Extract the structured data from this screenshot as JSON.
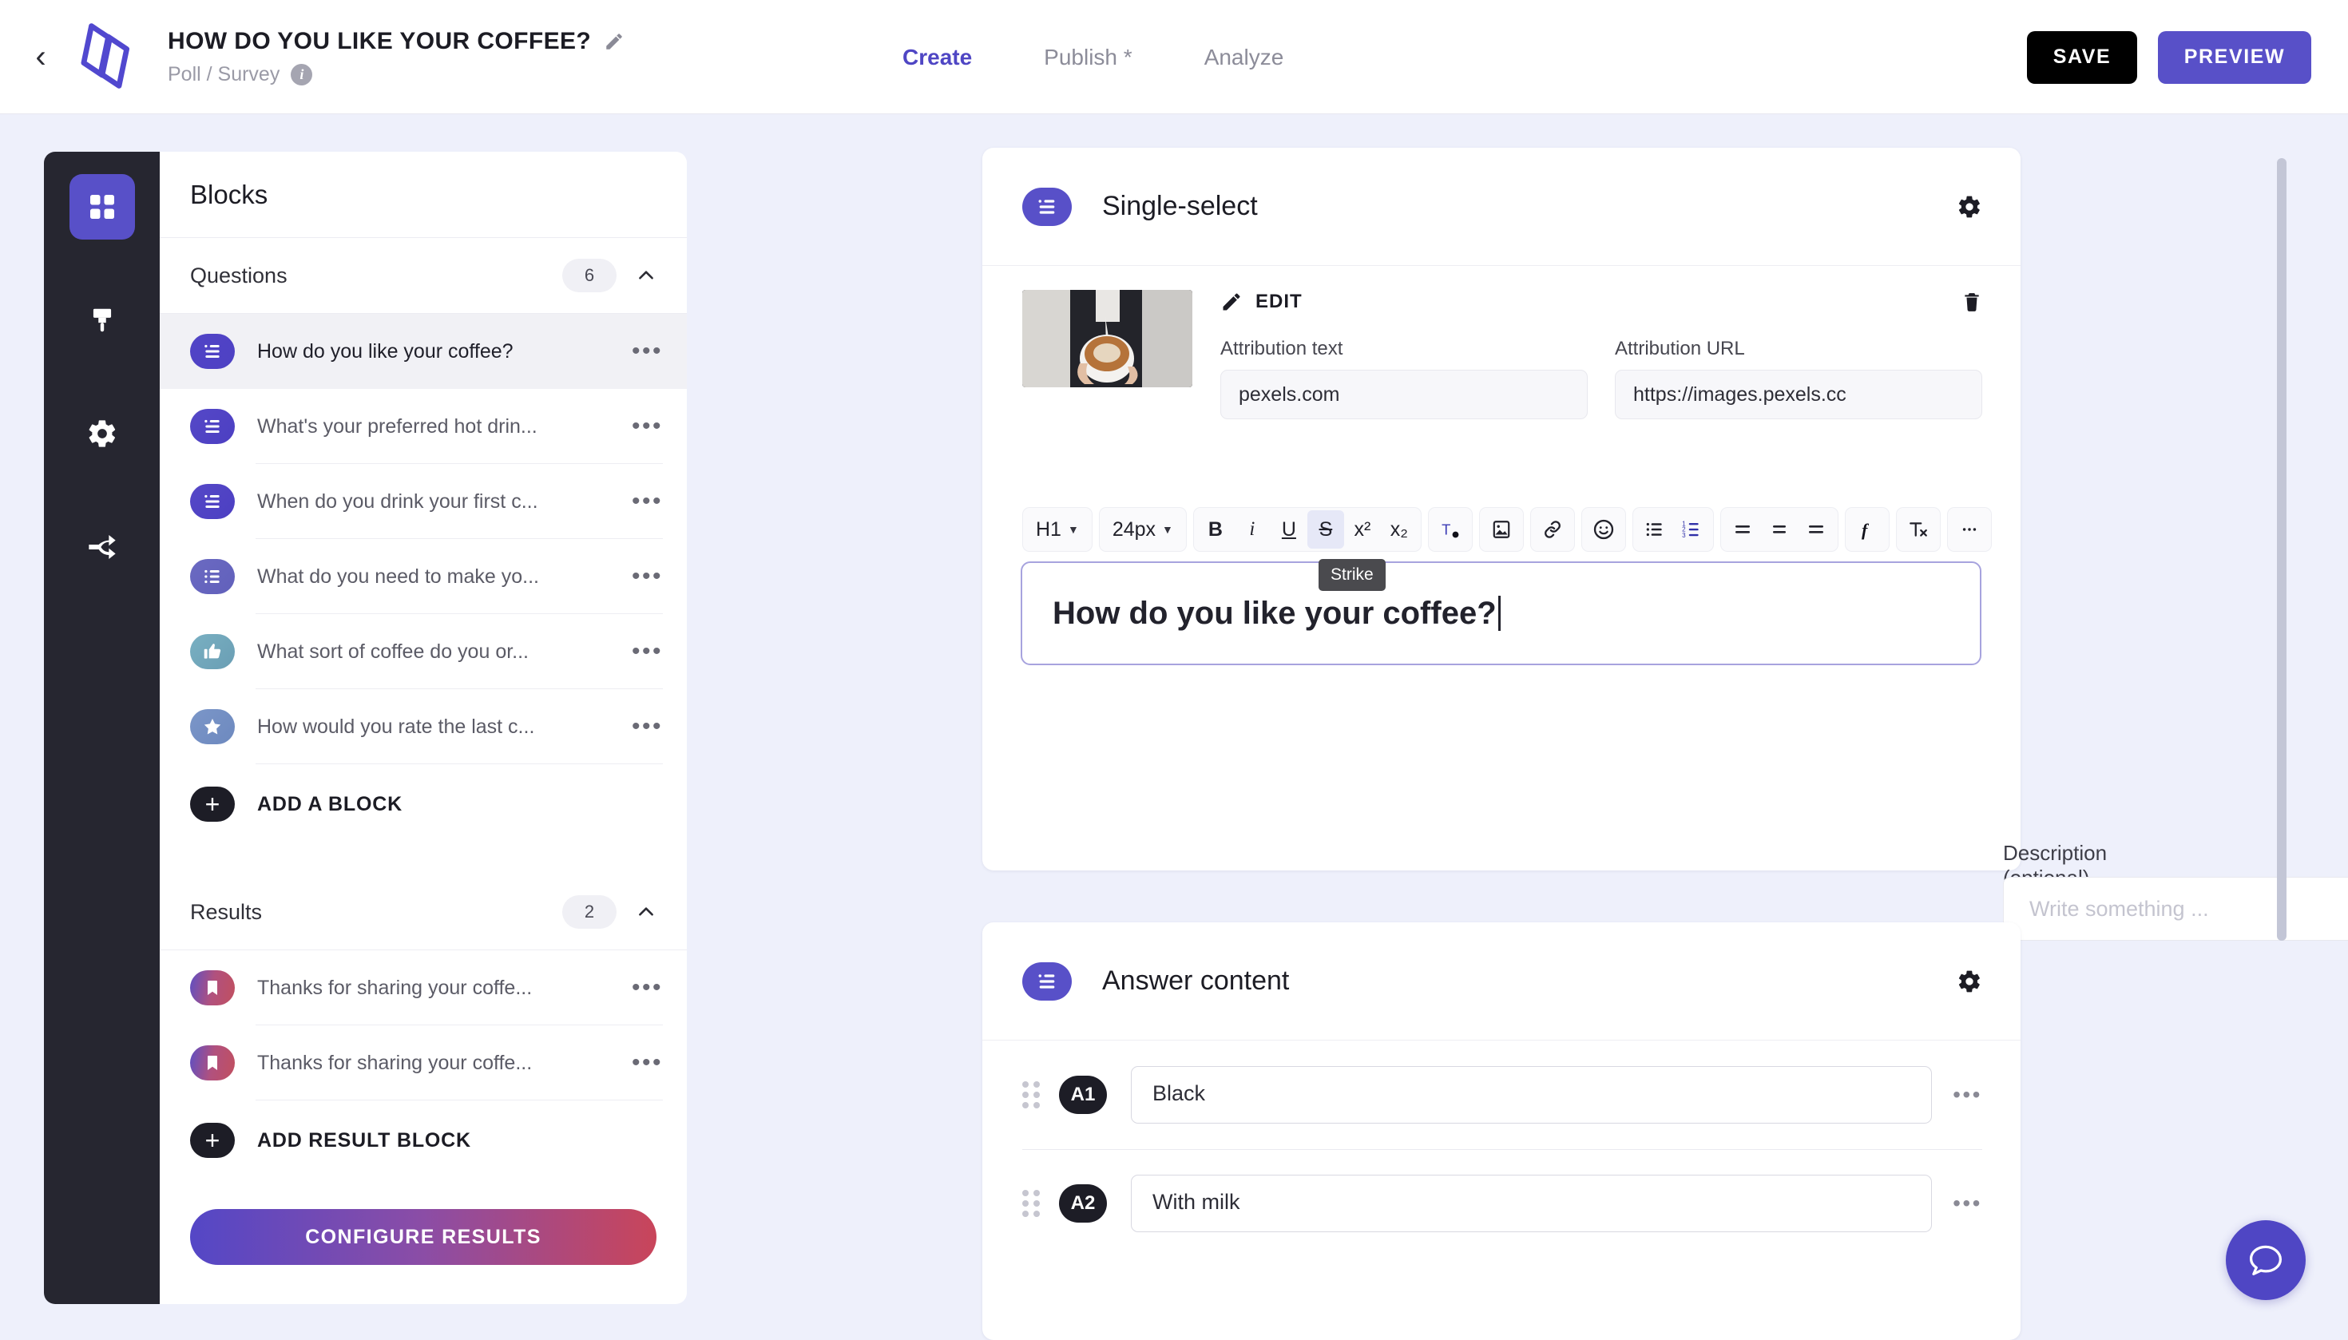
{
  "header": {
    "back_icon": "chevron-left-icon",
    "logo_icon": "brand-logo-icon",
    "project_title": "HOW DO YOU LIKE YOUR COFFEE?",
    "edit_title_icon": "pencil-icon",
    "project_type": "Poll / Survey",
    "type_info_icon": "info-icon",
    "tabs": [
      {
        "label": "Create",
        "active": true
      },
      {
        "label": "Publish *",
        "active": false
      },
      {
        "label": "Analyze",
        "active": false
      }
    ],
    "save_label": "SAVE",
    "preview_label": "PREVIEW",
    "save_color": "#000000",
    "preview_color": "#5850c8"
  },
  "rail": {
    "items": [
      {
        "icon": "grid-blocks-icon",
        "active": true
      },
      {
        "icon": "paint-brush-icon",
        "active": false
      },
      {
        "icon": "gear-icon",
        "active": false
      },
      {
        "icon": "share-branch-icon",
        "active": false
      }
    ],
    "active_color": "#5850c8",
    "background": "#262630"
  },
  "blocks_panel": {
    "title": "Blocks",
    "questions_section": {
      "title": "Questions",
      "count": "6",
      "collapse_icon": "chevron-up-icon",
      "items": [
        {
          "label": "How do you like your coffee?",
          "icon": "single-select-icon",
          "color": "#5144c6",
          "selected": true
        },
        {
          "label": "What's your preferred hot drin...",
          "icon": "single-select-icon",
          "color": "#5144c6",
          "selected": false
        },
        {
          "label": "When do you drink your first c...",
          "icon": "single-select-icon",
          "color": "#5144c6",
          "selected": false
        },
        {
          "label": "What do you need to make yo...",
          "icon": "multi-select-icon",
          "color": "#6a6ac0",
          "selected": false
        },
        {
          "label": "What sort of coffee do you or...",
          "icon": "thumbs-up-icon",
          "color": "#72a8bd",
          "selected": false
        },
        {
          "label": "How would you rate the last c...",
          "icon": "star-icon",
          "color": "#7490c4",
          "selected": false
        }
      ],
      "add_label": "ADD A BLOCK",
      "add_icon": "plus-icon"
    },
    "results_section": {
      "title": "Results",
      "count": "2",
      "collapse_icon": "chevron-up-icon",
      "items": [
        {
          "label": "Thanks for sharing your coffe...",
          "icon": "bookmark-icon"
        },
        {
          "label": "Thanks for sharing your coffe...",
          "icon": "bookmark-icon"
        }
      ],
      "add_label": "ADD RESULT BLOCK",
      "add_icon": "plus-icon"
    },
    "configure_label": "CONFIGURE RESULTS",
    "row_menu_icon": "ellipsis-icon"
  },
  "question_card": {
    "badge_icon": "single-select-icon",
    "title": "Single-select",
    "settings_icon": "gear-icon",
    "media": {
      "thumb_icon": "coffee-photo",
      "edit_label": "EDIT",
      "edit_icon": "pencil-icon",
      "delete_icon": "trash-icon",
      "attribution_text_label": "Attribution text",
      "attribution_text_value": "pexels.com",
      "attribution_url_label": "Attribution URL",
      "attribution_url_value": "https://images.pexels.cc"
    },
    "toolbar": {
      "heading_value": "H1",
      "size_value": "24px",
      "buttons": [
        {
          "icon": "bold-icon",
          "glyph": "B",
          "selected": false
        },
        {
          "icon": "italic-icon",
          "glyph": "i",
          "selected": false
        },
        {
          "icon": "underline-icon",
          "glyph": "U",
          "selected": false
        },
        {
          "icon": "strikethrough-icon",
          "glyph": "S",
          "selected": true
        },
        {
          "icon": "superscript-icon",
          "glyph": "x²",
          "selected": false
        },
        {
          "icon": "subscript-icon",
          "glyph": "x₂",
          "selected": false
        }
      ],
      "text_color_icon": "text-color-icon",
      "image_icon": "image-icon",
      "link_icon": "link-icon",
      "emoji_icon": "emoji-icon",
      "bullet_list_icon": "bullet-list-icon",
      "numbered_list_icon": "numbered-list-icon",
      "align_left_icon": "align-left-icon",
      "align_center_icon": "align-center-icon",
      "align_right_icon": "align-right-icon",
      "formula_icon": "formula-icon",
      "clear_format_icon": "clear-format-icon",
      "more_icon": "ellipsis-icon",
      "tooltip": "Strike"
    },
    "question_text": "How do you like your coffee?",
    "description_label": "Description (optional)",
    "description_info_icon": "info-icon",
    "description_value": "",
    "description_placeholder": "Write something ..."
  },
  "answer_card": {
    "badge_icon": "single-select-icon",
    "title": "Answer content",
    "settings_icon": "gear-icon",
    "rows": [
      {
        "grip_icon": "drag-handle-icon",
        "badge": "A1",
        "value": "Black",
        "menu_icon": "ellipsis-icon"
      },
      {
        "grip_icon": "drag-handle-icon",
        "badge": "A2",
        "value": "With milk",
        "menu_icon": "ellipsis-icon"
      }
    ]
  },
  "chat_fab": {
    "icon": "chat-bubble-icon",
    "color": "#4f46c4"
  },
  "scrollbar": {
    "icon": "vertical-scrollbar"
  }
}
